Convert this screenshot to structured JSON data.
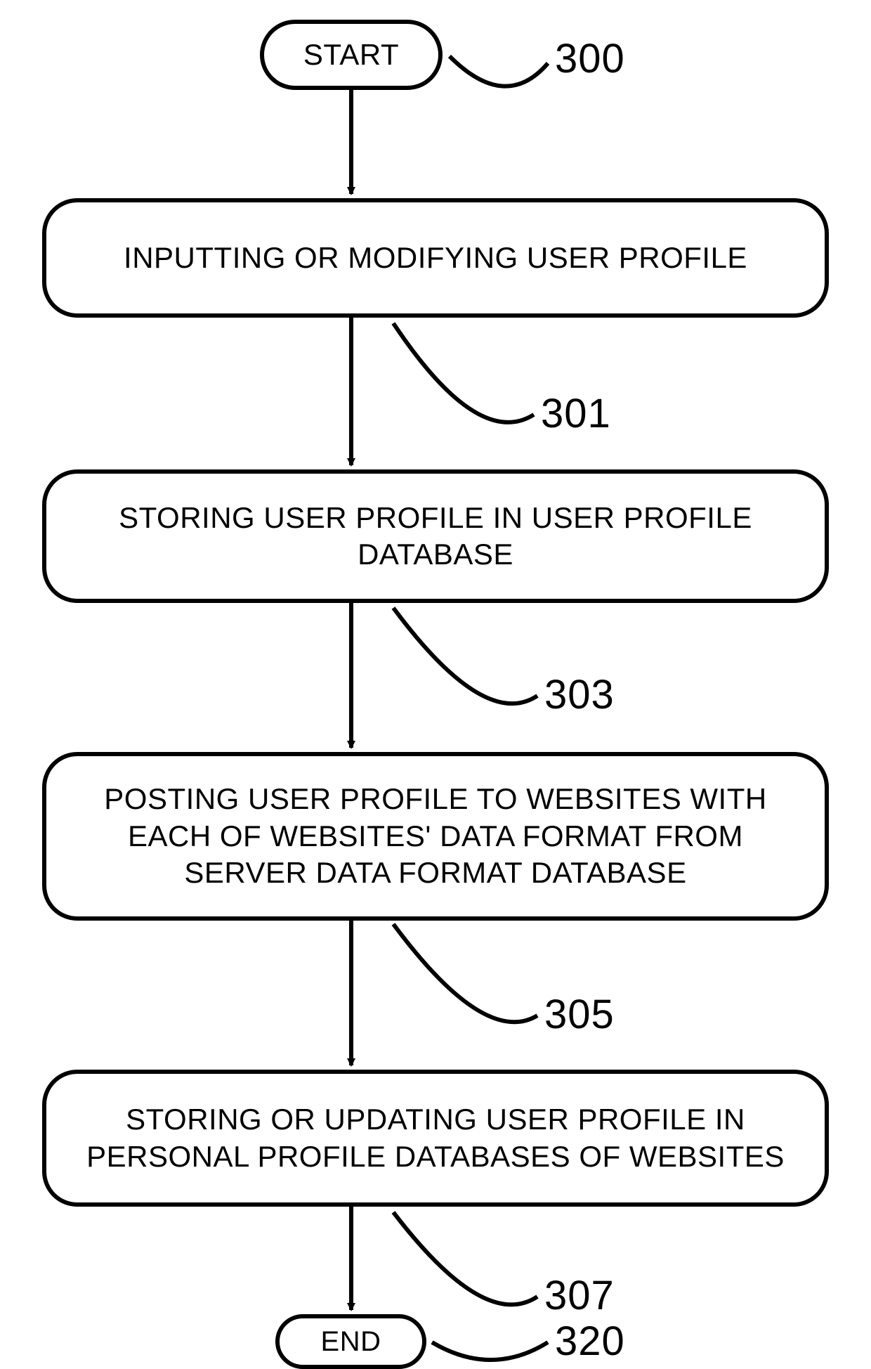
{
  "flowchart": {
    "start": {
      "label": "START",
      "ref": "300"
    },
    "steps": [
      {
        "text": "INPUTTING OR MODIFYING USER PROFILE",
        "ref": "301"
      },
      {
        "text": "STORING USER PROFILE IN USER PROFILE DATABASE",
        "ref": "303"
      },
      {
        "text": "POSTING USER PROFILE TO WEBSITES WITH EACH OF WEBSITES' DATA FORMAT FROM SERVER DATA FORMAT DATABASE",
        "ref": "305"
      },
      {
        "text": "STORING OR UPDATING USER PROFILE IN PERSONAL PROFILE DATABASES OF WEBSITES",
        "ref": "307"
      }
    ],
    "end": {
      "label": "END",
      "ref": "320"
    }
  }
}
